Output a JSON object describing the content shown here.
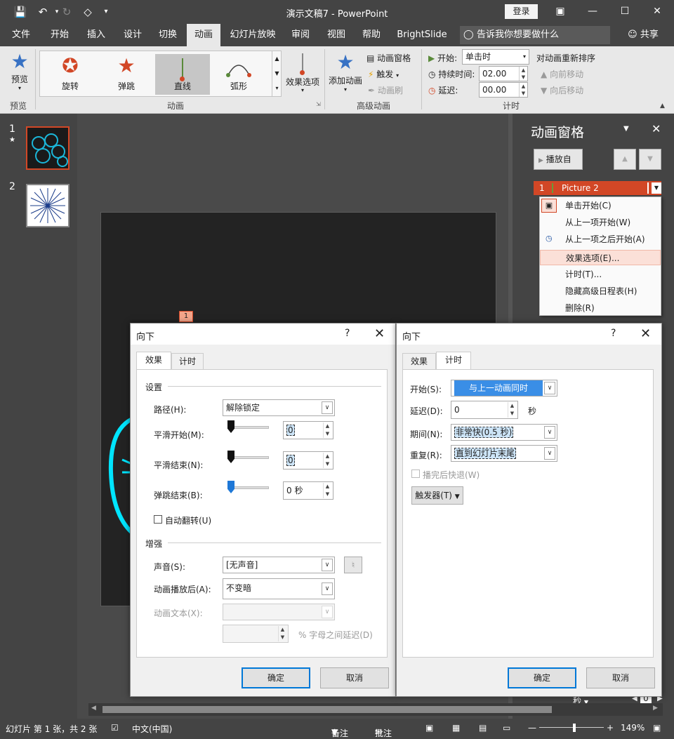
{
  "titlebar": {
    "title": "演示文稿7  -  PowerPoint",
    "login": "登录"
  },
  "tabs": [
    "文件",
    "开始",
    "插入",
    "设计",
    "切换",
    "动画",
    "幻灯片放映",
    "审阅",
    "视图",
    "帮助",
    "BrightSlide"
  ],
  "active_tab": "动画",
  "tellme": "告诉我你想要做什么",
  "share": "共享",
  "ribbon": {
    "preview": {
      "label": "预览",
      "group": "预览"
    },
    "gallery": [
      {
        "label": "旋转"
      },
      {
        "label": "弹跳"
      },
      {
        "label": "直线"
      },
      {
        "label": "弧形"
      }
    ],
    "effect_options": "效果选项",
    "animation_group": "动画",
    "add_animation": "添加动画",
    "anim_pane": "动画窗格",
    "trigger": "触发",
    "anim_painter": "动画刷",
    "advanced_group": "高级动画",
    "start_label": "开始:",
    "start_value": "单击时",
    "duration_label": "持续时间:",
    "duration_value": "02.00",
    "delay_label": "延迟:",
    "delay_value": "00.00",
    "timing_group": "计时",
    "reorder_title": "对动画重新排序",
    "move_earlier": "向前移动",
    "move_later": "向后移动"
  },
  "thumbs": [
    {
      "num": "1",
      "star": "★"
    },
    {
      "num": "2",
      "star": ""
    }
  ],
  "slide": {
    "anim_marker": "1"
  },
  "anim_pane": {
    "title": "动画窗格",
    "play_from": "播放自",
    "item_num": "1",
    "item_name": "Picture 2",
    "menu": [
      "单击开始(C)",
      "从上一项开始(W)",
      "从上一项之后开始(A)",
      "效果选项(E)...",
      "计时(T)...",
      "隐藏高级日程表(H)",
      "删除(R)"
    ],
    "seconds": "秒",
    "zero": "0"
  },
  "dialog_effect": {
    "title": "向下",
    "help": "?",
    "close": "✕",
    "tab_effect": "效果",
    "tab_timing": "计时",
    "settings_group": "设置",
    "path_label": "路径(H):",
    "path_value": "解除锁定",
    "smooth_start_label": "平滑开始(M):",
    "smooth_start_value": "0",
    "smooth_end_label": "平滑结束(N):",
    "smooth_end_value": "0",
    "bounce_end_label": "弹跳结束(B):",
    "bounce_end_value": "0 秒",
    "auto_reverse_label": "自动翻转(U)",
    "enhance_group": "增强",
    "sound_label": "声音(S):",
    "sound_value": "[无声音]",
    "after_anim_label": "动画播放后(A):",
    "after_anim_value": "不变暗",
    "anim_text_label": "动画文本(X):",
    "anim_text_value": "",
    "letter_delay_label": "% 字母之间延迟(D)",
    "ok": "确定",
    "cancel": "取消"
  },
  "dialog_timing": {
    "title": "向下",
    "help": "?",
    "close": "✕",
    "tab_effect": "效果",
    "tab_timing": "计时",
    "start_label": "开始(S):",
    "start_value": "与上一动画同时",
    "delay_label": "延迟(D):",
    "delay_value": "0",
    "delay_unit": "秒",
    "period_label": "期间(N):",
    "period_value": "非常快(0.5 秒)",
    "repeat_label": "重复(R):",
    "repeat_value": "直到幻灯片末尾",
    "rewind_label": "播完后快退(W)",
    "triggers": "触发器(T)",
    "ok": "确定",
    "cancel": "取消"
  },
  "status": {
    "slide_info": "幻灯片 第 1 张，共 2 张",
    "language": "中文(中国)",
    "notes": "备注",
    "comments": "批注",
    "zoom": "149%"
  },
  "colors": {
    "accent": "#d24726",
    "dark_ui": "#444444",
    "ribbon_bg": "#e8e8e8",
    "dialog_blue": "#0078d7",
    "cyan_drawing": "#00e5ff"
  }
}
